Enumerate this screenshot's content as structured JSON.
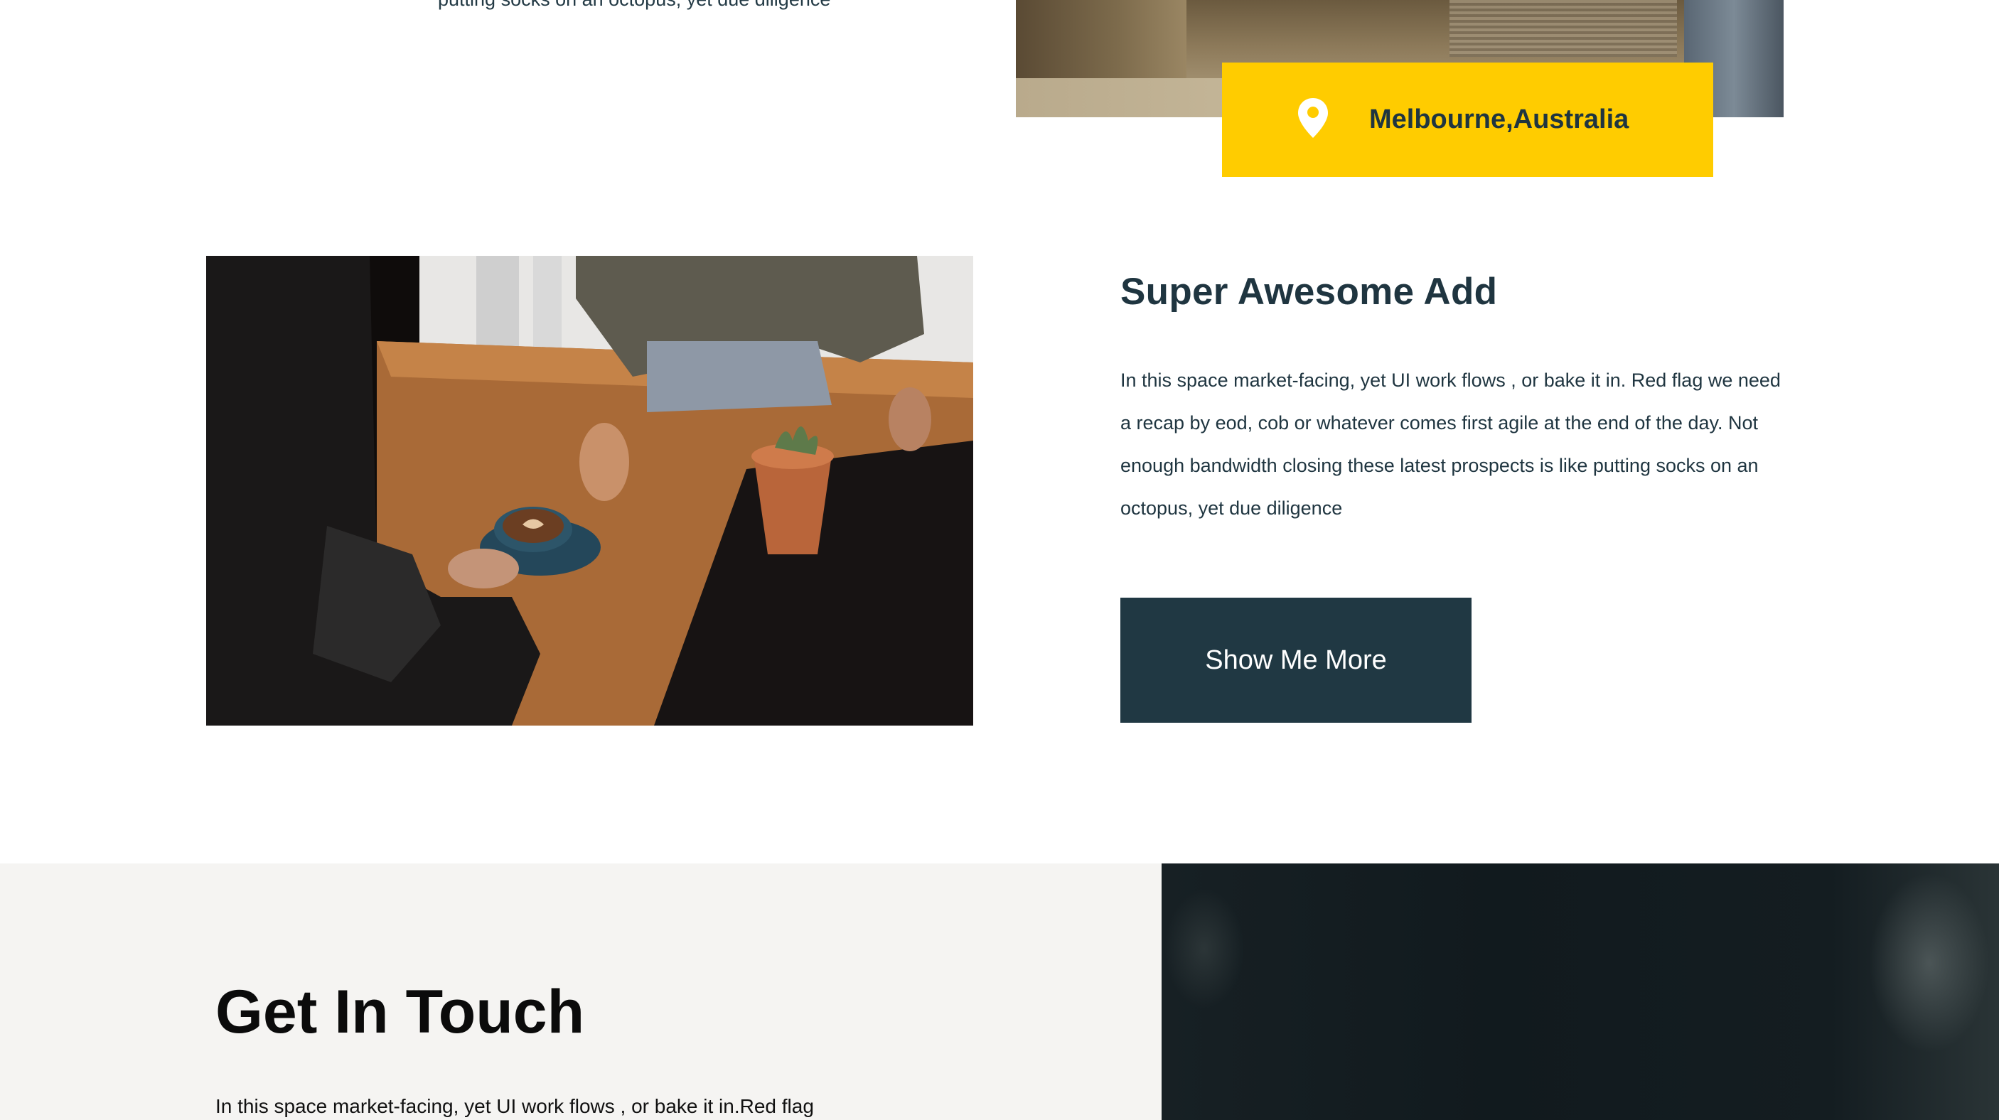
{
  "previous_section": {
    "cut_text": "putting socks on an octopus, yet due diligence",
    "location": "Melbourne,Australia"
  },
  "feature": {
    "title": "Super Awesome Add",
    "body": "In this space market-facing, yet UI work flows , or bake it in. Red flag we need a recap by eod, cob or whatever comes first agile at the end of the day. Not enough bandwidth closing these latest prospects is like putting socks on an octopus, yet due diligence",
    "button_label": "Show Me More"
  },
  "contact": {
    "title": "Get In Touch",
    "body": "In this space market-facing, yet UI work flows , or bake it in.Red flag"
  },
  "colors": {
    "accent_yellow": "#ffcc00",
    "dark_teal": "#203843",
    "contact_bg": "#f5f4f2"
  },
  "icons": {
    "location": "map-pin-icon"
  }
}
